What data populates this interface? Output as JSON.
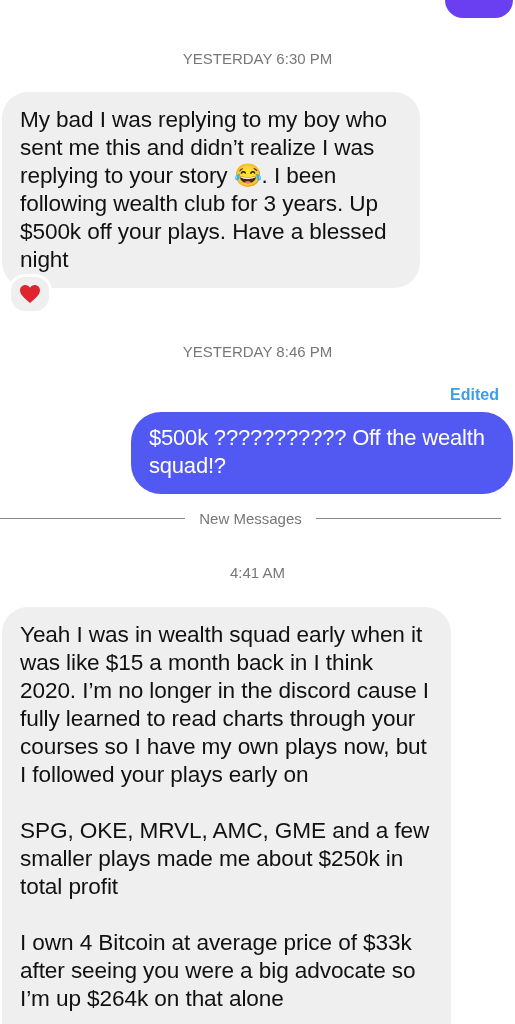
{
  "messages": [
    {
      "kind": "outgoing-fragment"
    },
    {
      "kind": "timestamp",
      "text": "YESTERDAY 6:30 PM"
    },
    {
      "kind": "incoming",
      "paragraphs": [
        "My bad I was replying to my boy who sent me this and didn’t realize I was replying to your story 😂. I been following wealth club for 3 years. Up $500k off your plays. Have a blessed night"
      ],
      "reacted": true
    },
    {
      "kind": "timestamp",
      "text": "YESTERDAY 8:46 PM"
    },
    {
      "kind": "outgoing",
      "edited_label": "Edited",
      "paragraphs": [
        "$500k ??????????? Off the wealth squad!?"
      ]
    },
    {
      "kind": "divider",
      "text": "New Messages"
    },
    {
      "kind": "timestamp",
      "text": "4:41 AM"
    },
    {
      "kind": "incoming",
      "paragraphs": [
        "Yeah I was in wealth squad early when it was like $15 a month back in I think 2020. I’m no longer in the discord cause I fully learned to read charts through your courses so I have my own plays now, but I followed your plays early on",
        "SPG, OKE, MRVL, AMC, GME and a few smaller plays made me about $250k in total profit",
        "I own 4 Bitcoin at average price of $33k after seeing you were a big advocate so I’m up $264k on that alone"
      ]
    }
  ]
}
